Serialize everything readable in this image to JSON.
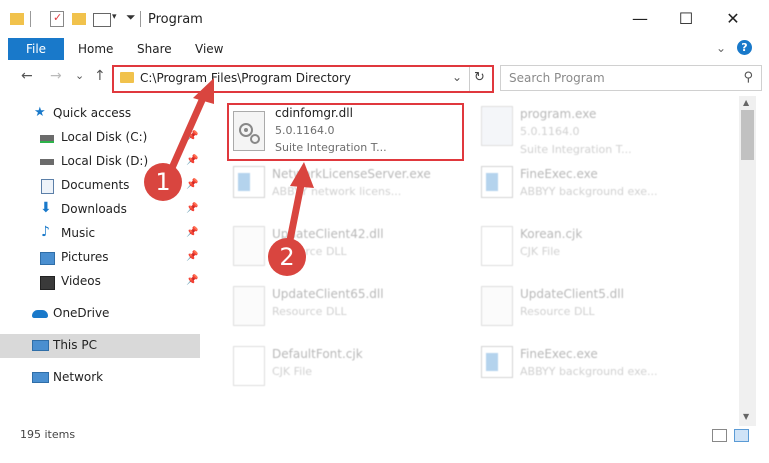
{
  "window": {
    "title": "Program",
    "minimize": "—",
    "maximize": "☐",
    "close": "✕"
  },
  "ribbon": {
    "file": "File",
    "home": "Home",
    "share": "Share",
    "view": "View",
    "expand": "⌄",
    "help": "?"
  },
  "nav": {
    "back": "←",
    "forward": "→",
    "recent": "⌄",
    "up": "↑",
    "address": "C:\\Program Files\\Program Directory",
    "address_dropdown": "⌄",
    "refresh": "↻",
    "search_placeholder": "Search Program",
    "search_icon": "⚲"
  },
  "sidebar": {
    "items": [
      {
        "label": "Quick access",
        "icon": "star-icon",
        "pinned": false
      },
      {
        "label": "Local Disk (C:)",
        "icon": "drive-icon",
        "pinned": true
      },
      {
        "label": "Local Disk (D:)",
        "icon": "drive-icon",
        "pinned": true
      },
      {
        "label": "Documents",
        "icon": "documents-icon",
        "pinned": true
      },
      {
        "label": "Downloads",
        "icon": "download-icon",
        "pinned": true
      },
      {
        "label": "Music",
        "icon": "music-icon",
        "pinned": true
      },
      {
        "label": "Pictures",
        "icon": "pictures-icon",
        "pinned": true
      },
      {
        "label": "Videos",
        "icon": "videos-icon",
        "pinned": true
      },
      {
        "label": "OneDrive",
        "icon": "cloud-icon",
        "pinned": false
      },
      {
        "label": "This PC",
        "icon": "computer-icon",
        "pinned": false,
        "selected": true
      },
      {
        "label": "Network",
        "icon": "network-icon",
        "pinned": false
      }
    ],
    "pin_glyph": "📌"
  },
  "files": [
    {
      "name": "cdinfomgr.dll",
      "line2": "5.0.1164.0",
      "line3": "Suite Integration T...",
      "icon": "dll-gear-icon",
      "highlighted": true
    },
    {
      "name": "program.exe",
      "line2": "5.0.1164.0",
      "line3": "Suite Integration T...",
      "icon": "exe-icon"
    },
    {
      "name": "NetworkLicenseServer.exe",
      "line2": "ABBYY network licens...",
      "line3": "",
      "icon": "exe-window-icon"
    },
    {
      "name": "FineExec.exe",
      "line2": "ABBYY background exe...",
      "line3": "",
      "icon": "exe-window-icon"
    },
    {
      "name": "UpdateClient42.dll",
      "line2": "Resource DLL",
      "line3": "",
      "icon": "dll-gear-icon"
    },
    {
      "name": "Korean.cjk",
      "line2": "CJK File",
      "line3": "",
      "icon": "blank-file-icon"
    },
    {
      "name": "UpdateClient65.dll",
      "line2": "Resource DLL",
      "line3": "",
      "icon": "dll-gear-icon"
    },
    {
      "name": "UpdateClient5.dll",
      "line2": "Resource DLL",
      "line3": "",
      "icon": "dll-gear-icon"
    },
    {
      "name": "DefaultFont.cjk",
      "line2": "CJK File",
      "line3": "",
      "icon": "blank-file-icon"
    },
    {
      "name": "FineExec.exe",
      "line2": "ABBYY background exe...",
      "line3": "",
      "icon": "exe-window-icon"
    }
  ],
  "status": {
    "item_count": "195 items"
  },
  "callouts": [
    "1",
    "2"
  ],
  "colors": {
    "accent": "#1979ca",
    "highlight": "#e0383d",
    "callout": "#d9453f",
    "folder": "#f1c24c"
  }
}
